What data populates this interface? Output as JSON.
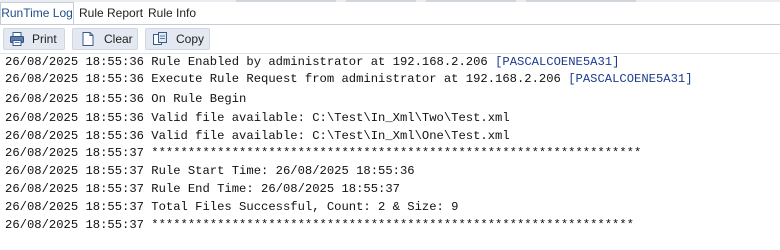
{
  "tabs": [
    {
      "label": "RunTime Log",
      "active": true
    },
    {
      "label": "Rule Report",
      "active": false
    },
    {
      "label": "Rule Info",
      "active": false
    }
  ],
  "toolbar": {
    "print_label": "Print",
    "clear_label": "Clear",
    "copy_label": "Copy"
  },
  "colors": {
    "accent": "#1f4e8c",
    "source_tag": "#1d3b8f",
    "button_bg": "#e4e9f1"
  },
  "log": [
    {
      "timestamp": "26/08/2025 18:55:36",
      "message": "Rule Enabled by administrator at 192.168.2.206",
      "source": "[PASCALCOENE5A31]"
    },
    {
      "timestamp": "26/08/2025 18:55:36",
      "message": "Execute Rule Request from administrator at 192.168.2.206",
      "source": "[PASCALCOENE5A31]"
    },
    {
      "timestamp": "26/08/2025 18:55:36",
      "message": "On Rule Begin",
      "source": ""
    },
    {
      "timestamp": "26/08/2025 18:55:36",
      "message": "Valid file available: C:\\Test\\In_Xml\\Two\\Test.xml",
      "source": ""
    },
    {
      "timestamp": "26/08/2025 18:55:36",
      "message": "Valid file available: C:\\Test\\In_Xml\\One\\Test.xml",
      "source": ""
    },
    {
      "timestamp": "26/08/2025 18:55:37",
      "message": "*******************************************************************",
      "source": ""
    },
    {
      "timestamp": "26/08/2025 18:55:37",
      "message": "Rule Start Time: 26/08/2025 18:55:36",
      "source": ""
    },
    {
      "timestamp": "26/08/2025 18:55:37",
      "message": "Rule End Time: 26/08/2025 18:55:37",
      "source": ""
    },
    {
      "timestamp": "26/08/2025 18:55:37",
      "message": "Total Files Successful, Count: 2 & Size: 9",
      "source": ""
    },
    {
      "timestamp": "26/08/2025 18:55:37",
      "message": "******************************************************************",
      "source": ""
    }
  ]
}
